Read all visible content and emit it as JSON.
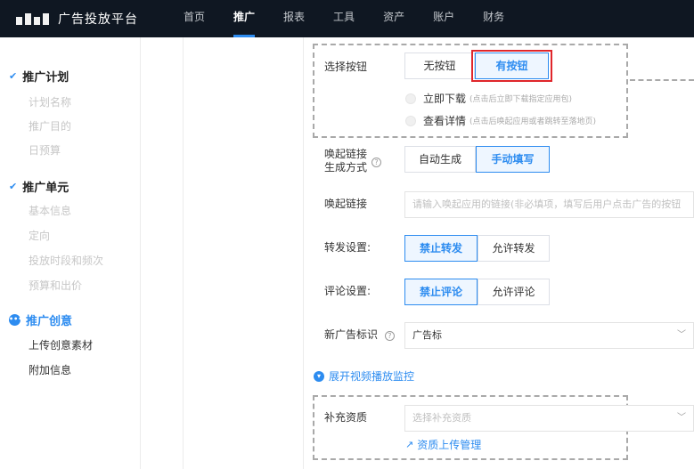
{
  "app": {
    "title": "广告投放平台"
  },
  "nav": [
    {
      "label": "首页",
      "active": false
    },
    {
      "label": "推广",
      "active": true
    },
    {
      "label": "报表",
      "active": false
    },
    {
      "label": "工具",
      "active": false
    },
    {
      "label": "资产",
      "active": false
    },
    {
      "label": "账户",
      "active": false
    },
    {
      "label": "财务",
      "active": false
    }
  ],
  "sidebar": {
    "groups": [
      {
        "label": "推广计划",
        "status": "done",
        "items": [
          "计划名称",
          "推广目的",
          "日预算"
        ]
      },
      {
        "label": "推广单元",
        "status": "done",
        "items": [
          "基本信息",
          "定向",
          "投放时段和频次",
          "预算和出价"
        ]
      },
      {
        "label": "推广创意",
        "status": "current",
        "items": [
          "上传创意素材",
          "附加信息"
        ]
      }
    ]
  },
  "form": {
    "button_choice": {
      "label": "选择按钮",
      "options": [
        "无按钮",
        "有按钮"
      ],
      "selected": "有按钮"
    },
    "button_actions": [
      {
        "label": "立即下载",
        "hint": "(点击后立即下载指定应用包)"
      },
      {
        "label": "查看详情",
        "hint": "(点击后唤起应用或者跳转至落地页)"
      }
    ],
    "deeplink_mode": {
      "label_line1": "唤起链接",
      "label_line2": "生成方式",
      "options": [
        "自动生成",
        "手动填写"
      ],
      "selected": "手动填写"
    },
    "deeplink": {
      "label": "唤起链接",
      "placeholder": "请输入唤起应用的链接(非必填项，填写后用户点击广告的按钮"
    },
    "forward": {
      "label": "转发设置:",
      "options": [
        "禁止转发",
        "允许转发"
      ],
      "selected": "禁止转发"
    },
    "comment": {
      "label": "评论设置:",
      "options": [
        "禁止评论",
        "允许评论"
      ],
      "selected": "禁止评论"
    },
    "ad_tag": {
      "label": "新广告标识",
      "value": "广告标"
    },
    "expand_monitor": {
      "label": "展开视频播放监控"
    },
    "qualification": {
      "label": "补充资质",
      "placeholder": "选择补充资质",
      "upload_link": "资质上传管理"
    }
  },
  "colors": {
    "accent": "#2d8cf0",
    "topbar": "#0f1722",
    "highlight": "#e0262b"
  }
}
